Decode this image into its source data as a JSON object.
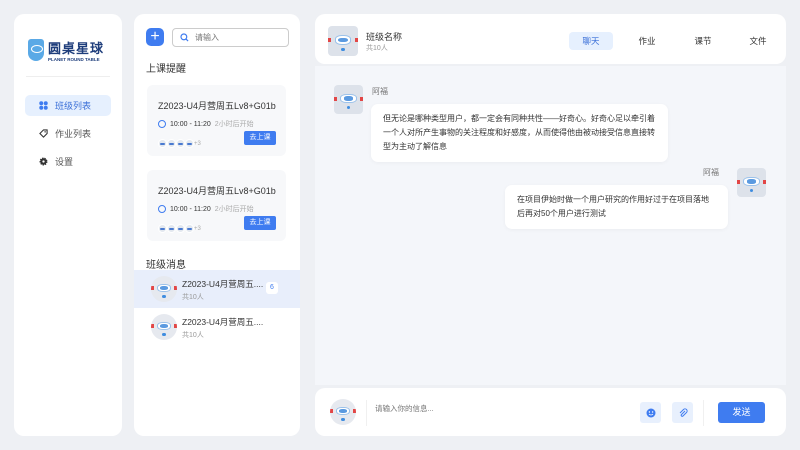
{
  "brand": {
    "name": "圆桌星球",
    "sub": "PLANET ROUND TABLE"
  },
  "sidebar": {
    "items": [
      {
        "label": "班级列表",
        "icon": "grid-icon",
        "active": true
      },
      {
        "label": "作业列表",
        "icon": "tag-icon"
      },
      {
        "label": "设置",
        "icon": "gear-icon"
      }
    ]
  },
  "middle": {
    "search_placeholder": "请输入",
    "reminder_title": "上课提醒",
    "reminders": [
      {
        "title": "Z2023-U4月营周五Lv8+G01b",
        "time": "10:00 - 11:20",
        "relative": "2小时后开始",
        "extra": "+3",
        "button": "去上课"
      },
      {
        "title": "Z2023-U4月营周五Lv8+G01b",
        "time": "10:00 - 11:20",
        "relative": "2小时后开始",
        "extra": "+3",
        "button": "去上课"
      }
    ],
    "messages_title": "班级消息",
    "conversations": [
      {
        "name": "Z2023-U4月营周五....",
        "count": "共10人",
        "badge": "6",
        "active": true
      },
      {
        "name": "Z2023-U4月营周五....",
        "count": "共10人"
      }
    ]
  },
  "header": {
    "class_name": "班级名称",
    "count": "共10人",
    "tabs": [
      "聊天",
      "作业",
      "课节",
      "文件"
    ],
    "active_tab": "聊天"
  },
  "chat": {
    "messages": [
      {
        "sender": "阿福",
        "side": "left",
        "text": "但无论是哪种类型用户，都一定会有同种共性——好奇心。好奇心足以牵引着一个人对所产生事物的关注程度和好感度，从而使得他由被动接受信息直接转型为主动了解信息"
      },
      {
        "sender": "阿福",
        "side": "right",
        "text": "在项目伊始时做一个用户研究的作用好过于在项目落地后再对50个用户进行测试"
      }
    ]
  },
  "input": {
    "placeholder": "请输入你的信息...",
    "send": "发送"
  },
  "colors": {
    "accent": "#3f7cf0",
    "active_bg": "#e6f0fe"
  }
}
